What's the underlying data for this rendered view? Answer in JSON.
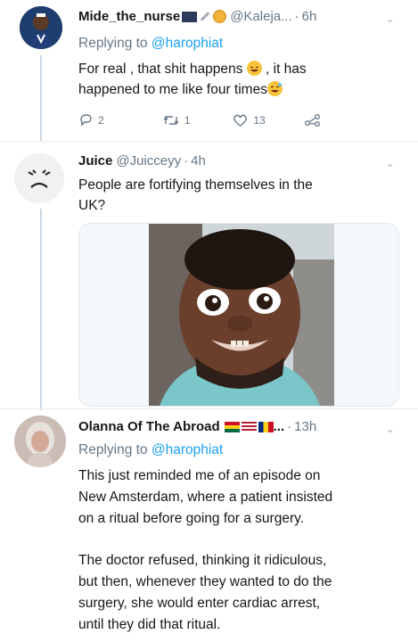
{
  "tweets": [
    {
      "name": "Mide_the_nurse",
      "handle": "@Kaleja...",
      "time": "6h",
      "reply_prefix": "Replying to ",
      "reply_mention": "@harophiat",
      "body_line1_a": "For real , that shit happens",
      "body_line1_b": ", it has",
      "body_line2": "happened to me like four times",
      "replies": "2",
      "retweets": "1",
      "likes": "13"
    },
    {
      "name": "Juice",
      "handle": "@Juicceyy",
      "time": "4h",
      "body_line1": "People are fortifying themselves in the",
      "body_line2": "UK?"
    },
    {
      "name": "Olanna Of The Abroad",
      "name_suffix": "...",
      "time": "13h",
      "reply_prefix": "Replying to ",
      "reply_mention": "@harophiat",
      "body_lines": [
        "This just reminded me of an episode on",
        "New Amsterdam, where a patient insisted",
        "on a ritual before going for a surgery.",
        "",
        "The doctor refused, thinking it ridiculous,",
        "but then, whenever they wanted to do the",
        "surgery, she would enter cardiac arrest,",
        "until they did that ritual."
      ]
    }
  ],
  "icons": {
    "reply": "reply-icon",
    "retweet": "retweet-icon",
    "like": "heart-icon",
    "share": "share-icon",
    "more": "chevron-down-icon"
  },
  "colors": {
    "link": "#1da1f2",
    "secondary": "#657786",
    "thread_line": "#ccd6dd"
  }
}
